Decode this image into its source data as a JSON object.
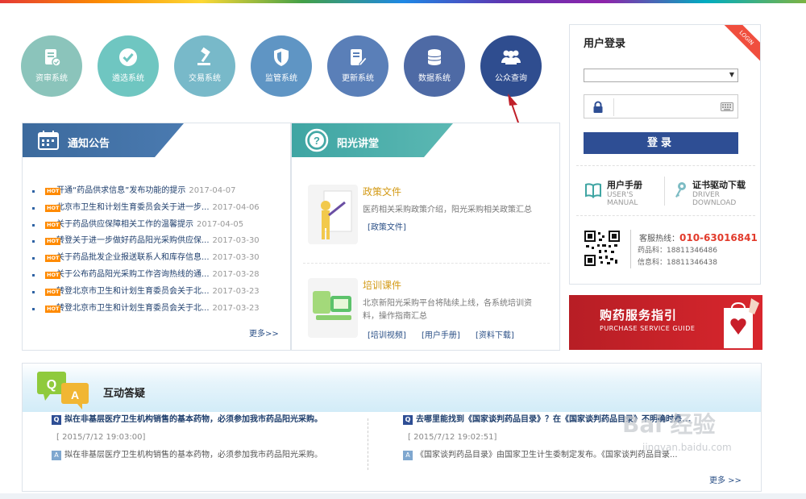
{
  "nav": [
    {
      "label": "资审系统",
      "color": "#8bc4bb"
    },
    {
      "label": "遴选系统",
      "color": "#6fc6c1"
    },
    {
      "label": "交易系统",
      "color": "#78b9c9"
    },
    {
      "label": "监管系统",
      "color": "#5f95c4"
    },
    {
      "label": "更新系统",
      "color": "#5a7fb8"
    },
    {
      "label": "数据系统",
      "color": "#4e6aa5"
    },
    {
      "label": "公众查询",
      "color": "#2f4d8f"
    }
  ],
  "notice": {
    "title": "通知公告",
    "hot": "HOT",
    "items": [
      {
        "text": "开通“药品供求信息”发布功能的提示",
        "date": "2017-04-07"
      },
      {
        "text": "北京市卫生和计划生育委员会关于进一步...",
        "date": "2017-04-06"
      },
      {
        "text": "关于药品供应保障相关工作的温馨提示",
        "date": "2017-04-05"
      },
      {
        "text": "转登关于进一步做好药品阳光采购供应保...",
        "date": "2017-03-30"
      },
      {
        "text": "关于药品批发企业报送联系人和库存信息...",
        "date": "2017-03-30"
      },
      {
        "text": "关于公布药品阳光采购工作咨询热线的通...",
        "date": "2017-03-28"
      },
      {
        "text": "转登北京市卫生和计划生育委员会关于北...",
        "date": "2017-03-23"
      },
      {
        "text": "转登北京市卫生和计划生育委员会关于北...",
        "date": "2017-03-23"
      }
    ],
    "more": "更多>>"
  },
  "sun": {
    "title": "阳光讲堂",
    "policy": {
      "title": "政策文件",
      "desc": "医药相关采购政策介绍，阳光采购相关政策汇总",
      "links": [
        "[政策文件]"
      ]
    },
    "training": {
      "title": "培训课件",
      "desc": "北京新阳光采购平台将陆续上线，各系统培训资料，操作指南汇总",
      "links": [
        "[培训视频]",
        "[用户手册]",
        "[资料下载]"
      ]
    }
  },
  "login": {
    "title": "用户登录",
    "ribbon": "LOGIN",
    "select_value": "",
    "button": "登录",
    "manual": {
      "title": "用户手册",
      "sub1": "USER'S",
      "sub2": "MANUAL"
    },
    "driver": {
      "title": "证书驱动下载",
      "sub1": "DRIVER",
      "sub2": "DOWNLOAD"
    },
    "hotline_label": "客服热线：",
    "hotline": "010-63016841",
    "line1": "药品科：18811346486",
    "line2": "信息科：18811346438"
  },
  "banner": {
    "title": "购药服务指引",
    "subtitle": "PURCHASE SERVICE GUIDE"
  },
  "qa": {
    "title": "互动答疑",
    "bubble_q": "Q",
    "bubble_a": "A",
    "items": [
      {
        "q": "拟在非基层医疗卫生机构销售的基本药物，必须参加我市药品阳光采购。",
        "date": "[ 2015/7/12 19:03:00]",
        "a": "拟在非基层医疗卫生机构销售的基本药物，必须参加我市药品阳光采购。"
      },
      {
        "q": "去哪里能找到《国家谈判药品目录》？在《国家谈判药品目录》不明确时是...",
        "date": "[ 2015/7/12 19:02:51]",
        "a": "《国家谈判药品目录》由国家卫生计生委制定发布。《国家谈判药品目录..."
      }
    ],
    "badge_q": "Q",
    "badge_a": "A",
    "more": "更多 >>"
  },
  "watermark": {
    "main": "Bai 经验",
    "sub": "jingyan.baidu.com"
  }
}
